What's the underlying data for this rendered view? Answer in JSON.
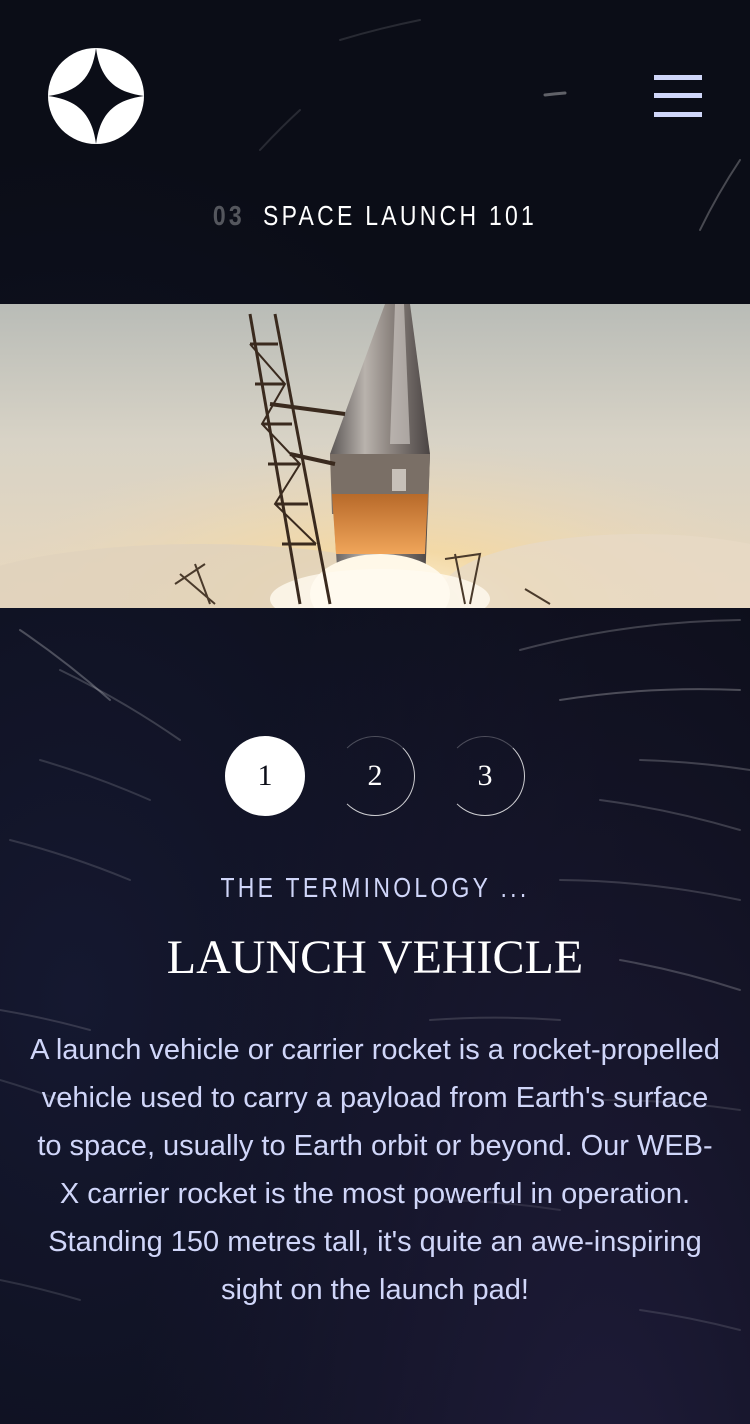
{
  "header": {
    "logo": "star-logo",
    "menu_icon": "hamburger-menu-icon"
  },
  "page": {
    "number": "03",
    "title": "SPACE LAUNCH 101"
  },
  "hero_image": {
    "subject": "rocket-launch-photo"
  },
  "pager": {
    "items": [
      "1",
      "2",
      "3"
    ],
    "active_index": 0
  },
  "content": {
    "eyebrow": "THE TERMINOLOGY ...",
    "title": "LAUNCH VEHICLE",
    "description": "A launch vehicle or carrier rocket is a rocket-propelled vehicle used to carry a payload from Earth's surface to space, usually to Earth orbit or beyond. Our WEB-X carrier rocket is the most powerful in operation. Standing 150 metres tall, it's quite an awe-inspiring sight on the launch pad!"
  },
  "colors": {
    "background": "#0b0d17",
    "accent_light": "#d0d6f9",
    "white": "#ffffff"
  }
}
